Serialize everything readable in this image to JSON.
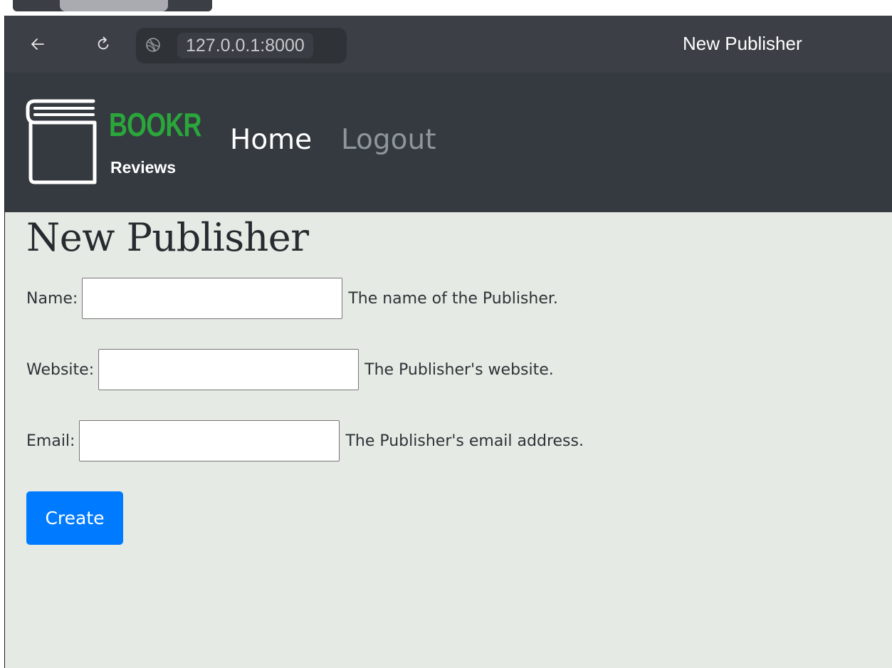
{
  "browser": {
    "url": "127.0.0.1:8000",
    "tab_title": "New Publisher",
    "icons": [
      "back-arrow-icon",
      "reload-icon",
      "site-info-icon"
    ]
  },
  "navbar": {
    "brand_word": "BOOKR",
    "brand_sub": "Reviews",
    "links": {
      "home": "Home",
      "logout": "Logout"
    }
  },
  "page": {
    "title": "New Publisher",
    "form": {
      "name": {
        "label": "Name:",
        "value": "",
        "help": "The name of the Publisher."
      },
      "website": {
        "label": "Website:",
        "value": "",
        "help": "The Publisher's website."
      },
      "email": {
        "label": "Email:",
        "value": "",
        "help": "The Publisher's email address."
      },
      "submit_label": "Create"
    }
  },
  "colors": {
    "navbar_bg": "#343a40",
    "page_bg": "#e5eae4",
    "brand_green": "#2aa63b",
    "primary_button": "#007bff"
  }
}
